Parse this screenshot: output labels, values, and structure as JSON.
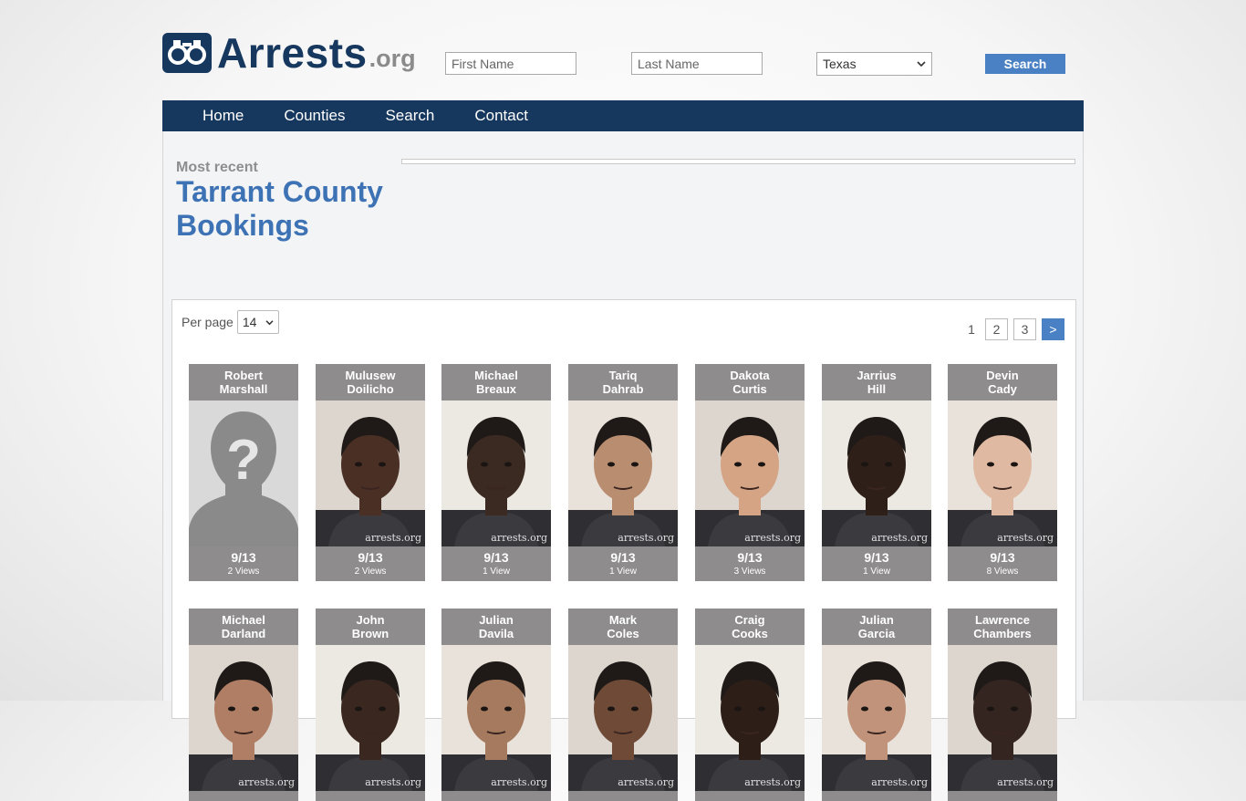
{
  "header": {
    "logo_main": "Arrests",
    "logo_tld": ".org",
    "first_name_placeholder": "First Name",
    "last_name_placeholder": "Last Name",
    "state_selected": "Texas",
    "search_label": "Search"
  },
  "nav": {
    "items": [
      "Home",
      "Counties",
      "Search",
      "Contact"
    ]
  },
  "main": {
    "kicker": "Most recent",
    "title": "Tarrant County Bookings"
  },
  "listing": {
    "per_page_label": "Per page",
    "per_page_value": "14",
    "pagination": {
      "current": "1",
      "pages": [
        "2",
        "3"
      ],
      "next": ">"
    },
    "watermark": "arrests.org",
    "bookings": [
      {
        "first": "Robert",
        "last": "Marshall",
        "date": "9/13",
        "views": "2 Views",
        "photo": "placeholder",
        "skin": "#888"
      },
      {
        "first": "Mulusew",
        "last": "Doilicho",
        "date": "9/13",
        "views": "2 Views",
        "photo": "mugshot",
        "skin": "#4a2f24"
      },
      {
        "first": "Michael",
        "last": "Breaux",
        "date": "9/13",
        "views": "1 View",
        "photo": "mugshot",
        "skin": "#3b2a22"
      },
      {
        "first": "Tariq",
        "last": "Dahrab",
        "date": "9/13",
        "views": "1 View",
        "photo": "mugshot",
        "skin": "#b98d70"
      },
      {
        "first": "Dakota",
        "last": "Curtis",
        "date": "9/13",
        "views": "3 Views",
        "photo": "mugshot",
        "skin": "#d4a485"
      },
      {
        "first": "Jarrius",
        "last": "Hill",
        "date": "9/13",
        "views": "1 View",
        "photo": "mugshot",
        "skin": "#2e1f19"
      },
      {
        "first": "Devin",
        "last": "Cady",
        "date": "9/13",
        "views": "8 Views",
        "photo": "mugshot",
        "skin": "#e0b9a2"
      },
      {
        "first": "Michael",
        "last": "Darland",
        "date": "",
        "views": "",
        "photo": "mugshot",
        "skin": "#b07e64"
      },
      {
        "first": "John",
        "last": "Brown",
        "date": "",
        "views": "",
        "photo": "mugshot",
        "skin": "#3a2820"
      },
      {
        "first": "Julian",
        "last": "Davila",
        "date": "",
        "views": "",
        "photo": "mugshot",
        "skin": "#a67a5e"
      },
      {
        "first": "Mark",
        "last": "Coles",
        "date": "",
        "views": "",
        "photo": "mugshot",
        "skin": "#6e4a37"
      },
      {
        "first": "Craig",
        "last": "Cooks",
        "date": "",
        "views": "",
        "photo": "mugshot",
        "skin": "#2d1e18"
      },
      {
        "first": "Julian",
        "last": "Garcia",
        "date": "",
        "views": "",
        "photo": "mugshot",
        "skin": "#c0937a"
      },
      {
        "first": "Lawrence",
        "last": "Chambers",
        "date": "",
        "views": "",
        "photo": "mugshot",
        "skin": "#352520"
      }
    ]
  },
  "colors": {
    "brand_navy": "#16375e",
    "accent_blue": "#3d72b4",
    "button_blue": "#4a80c4",
    "card_gray": "#8e8c8c"
  }
}
